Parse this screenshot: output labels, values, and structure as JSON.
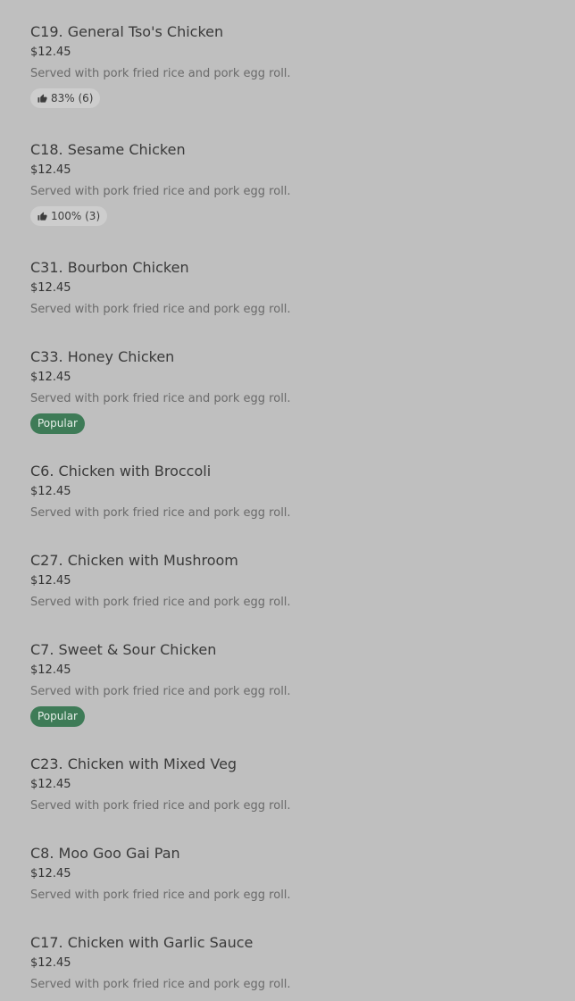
{
  "menu": {
    "items": [
      {
        "name": "C19. General Tso's Chicken",
        "price": "$12.45",
        "description": "Served with pork fried rice and pork egg roll.",
        "rating": "83% (6)",
        "popular": ""
      },
      {
        "name": "C18. Sesame Chicken",
        "price": "$12.45",
        "description": "Served with pork fried rice and pork egg roll.",
        "rating": "100% (3)",
        "popular": ""
      },
      {
        "name": "C31. Bourbon Chicken",
        "price": "$12.45",
        "description": "Served with pork fried rice and pork egg roll.",
        "rating": "",
        "popular": ""
      },
      {
        "name": "C33. Honey Chicken",
        "price": "$12.45",
        "description": "Served with pork fried rice and pork egg roll.",
        "rating": "",
        "popular": "Popular"
      },
      {
        "name": "C6. Chicken with Broccoli",
        "price": "$12.45",
        "description": "Served with pork fried rice and pork egg roll.",
        "rating": "",
        "popular": ""
      },
      {
        "name": "C27. Chicken with Mushroom",
        "price": "$12.45",
        "description": "Served with pork fried rice and pork egg roll.",
        "rating": "",
        "popular": ""
      },
      {
        "name": "C7. Sweet & Sour Chicken",
        "price": "$12.45",
        "description": "Served with pork fried rice and pork egg roll.",
        "rating": "",
        "popular": "Popular"
      },
      {
        "name": "C23. Chicken with Mixed Veg",
        "price": "$12.45",
        "description": "Served with pork fried rice and pork egg roll.",
        "rating": "",
        "popular": ""
      },
      {
        "name": "C8. Moo Goo Gai Pan",
        "price": "$12.45",
        "description": "Served with pork fried rice and pork egg roll.",
        "rating": "",
        "popular": ""
      },
      {
        "name": "C17. Chicken with Garlic Sauce",
        "price": "$12.45",
        "description": "Served with pork fried rice and pork egg roll.",
        "rating": "",
        "popular": ""
      }
    ],
    "icons": {
      "rating": "thumbs-up-icon"
    },
    "colors": {
      "background": "#bfbfbf",
      "popular_badge": "#3e7b57",
      "rating_badge": "#cdcdcd"
    }
  }
}
